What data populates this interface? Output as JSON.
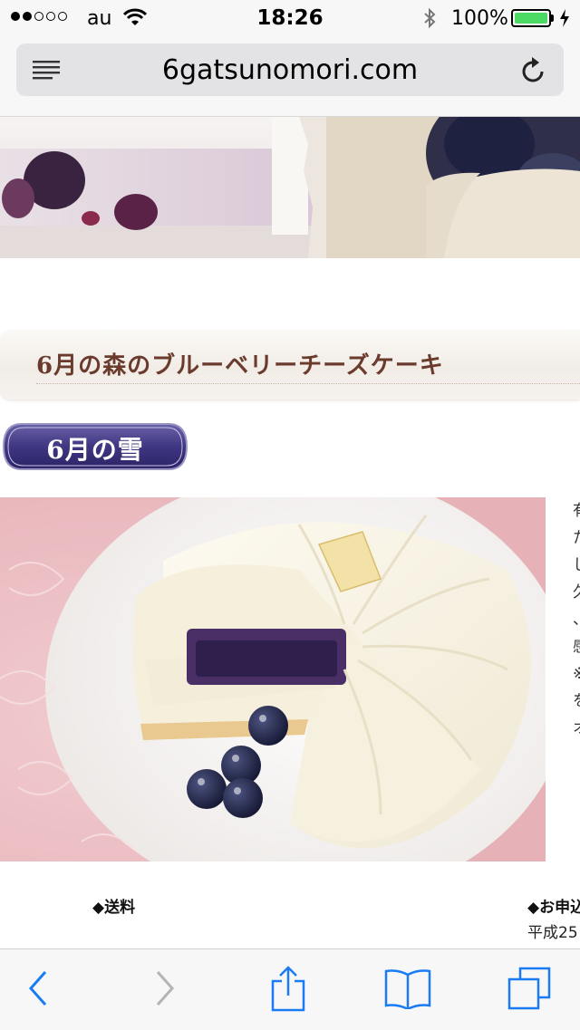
{
  "status_bar": {
    "carrier": "au",
    "time": "18:26",
    "battery_percent": "100%",
    "signal_bars_filled": 2,
    "signal_bars_total": 5,
    "icons": [
      "wifi-icon",
      "bluetooth-icon",
      "battery-icon",
      "charging-icon"
    ],
    "battery_color": "#4cd964"
  },
  "browser": {
    "url": "6gatsunomori.com",
    "icons": {
      "menu": "reader-lines-icon",
      "reload": "reload-icon"
    }
  },
  "page": {
    "section_title": "6月の森のブルーベリーチーズケーキ",
    "badge_label": "6月の雪",
    "shipping_heading": "◆送料",
    "apply_heading": "◆お申込",
    "apply_text": "平成25",
    "side_text_chars": [
      "有",
      "た",
      "し",
      "久",
      "、",
      "感",
      "※",
      "を",
      "オ"
    ],
    "accent_colors": {
      "badge": "#4a3f86",
      "title": "#6a3b2d"
    }
  },
  "toolbar": {
    "buttons": [
      "back-icon",
      "forward-icon",
      "share-icon",
      "bookmarks-icon",
      "tabs-icon"
    ],
    "accent": "#1a7cf5",
    "disabled": "#b4b4b4"
  }
}
